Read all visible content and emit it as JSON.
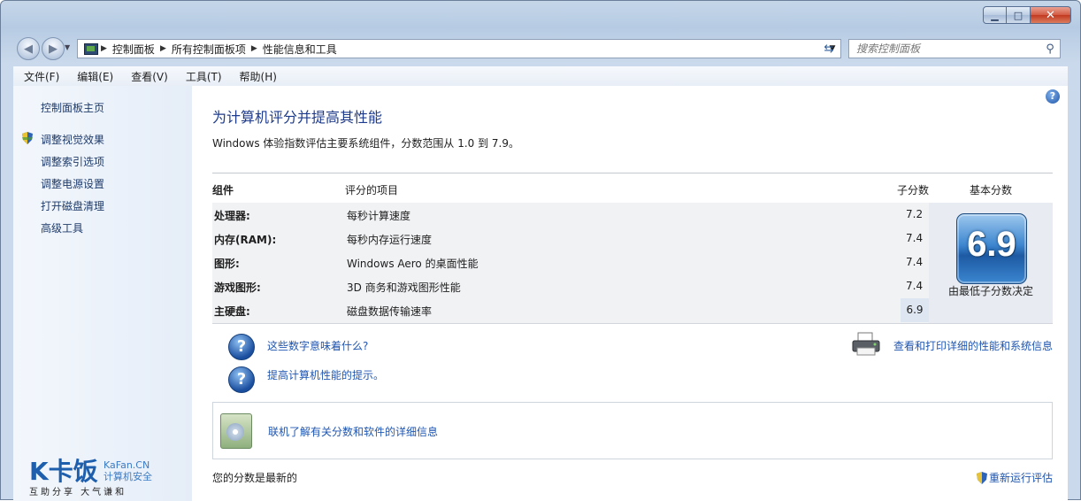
{
  "window": {
    "minimize_glyph": "▁",
    "maximize_glyph": "□",
    "close_glyph": "✕"
  },
  "address": {
    "crumbs": [
      "控制面板",
      "所有控制面板项",
      "性能信息和工具"
    ],
    "icon": "control-panel-icon"
  },
  "search": {
    "placeholder": "搜索控制面板"
  },
  "menu": [
    "文件(F)",
    "编辑(E)",
    "查看(V)",
    "工具(T)",
    "帮助(H)"
  ],
  "sidebar": {
    "home": "控制面板主页",
    "items": [
      "调整视觉效果",
      "调整索引选项",
      "调整电源设置",
      "打开磁盘清理",
      "高级工具"
    ]
  },
  "logo": {
    "brand": "K卡饭",
    "site": "KaFan.CN",
    "tagline": "计算机安全",
    "slogan": "互助分享  大气谦和"
  },
  "main": {
    "title": "为计算机评分并提高其性能",
    "description": "Windows 体验指数评估主要系统组件，分数范围从 1.0 到 7.9。",
    "table": {
      "headers": {
        "component": "组件",
        "item": "评分的项目",
        "subscore": "子分数",
        "base": "基本分数"
      },
      "rows": [
        {
          "component": "处理器:",
          "item": "每秒计算速度",
          "subscore": "7.2"
        },
        {
          "component": "内存(RAM):",
          "item": "每秒内存运行速度",
          "subscore": "7.4"
        },
        {
          "component": "图形:",
          "item": "Windows Aero 的桌面性能",
          "subscore": "7.4"
        },
        {
          "component": "游戏图形:",
          "item": "3D 商务和游戏图形性能",
          "subscore": "7.4"
        },
        {
          "component": "主硬盘:",
          "item": "磁盘数据传输速率",
          "subscore": "6.9"
        }
      ],
      "base_score": "6.9",
      "base_caption": "由最低子分数决定"
    },
    "links": {
      "what_numbers_mean": "这些数字意味着什么?",
      "tips": "提高计算机性能的提示。",
      "print_details": "查看和打印详细的性能和系统信息",
      "learn_more": "联机了解有关分数和软件的详细信息"
    },
    "status": "您的分数是最新的",
    "rerun": "重新运行评估"
  }
}
